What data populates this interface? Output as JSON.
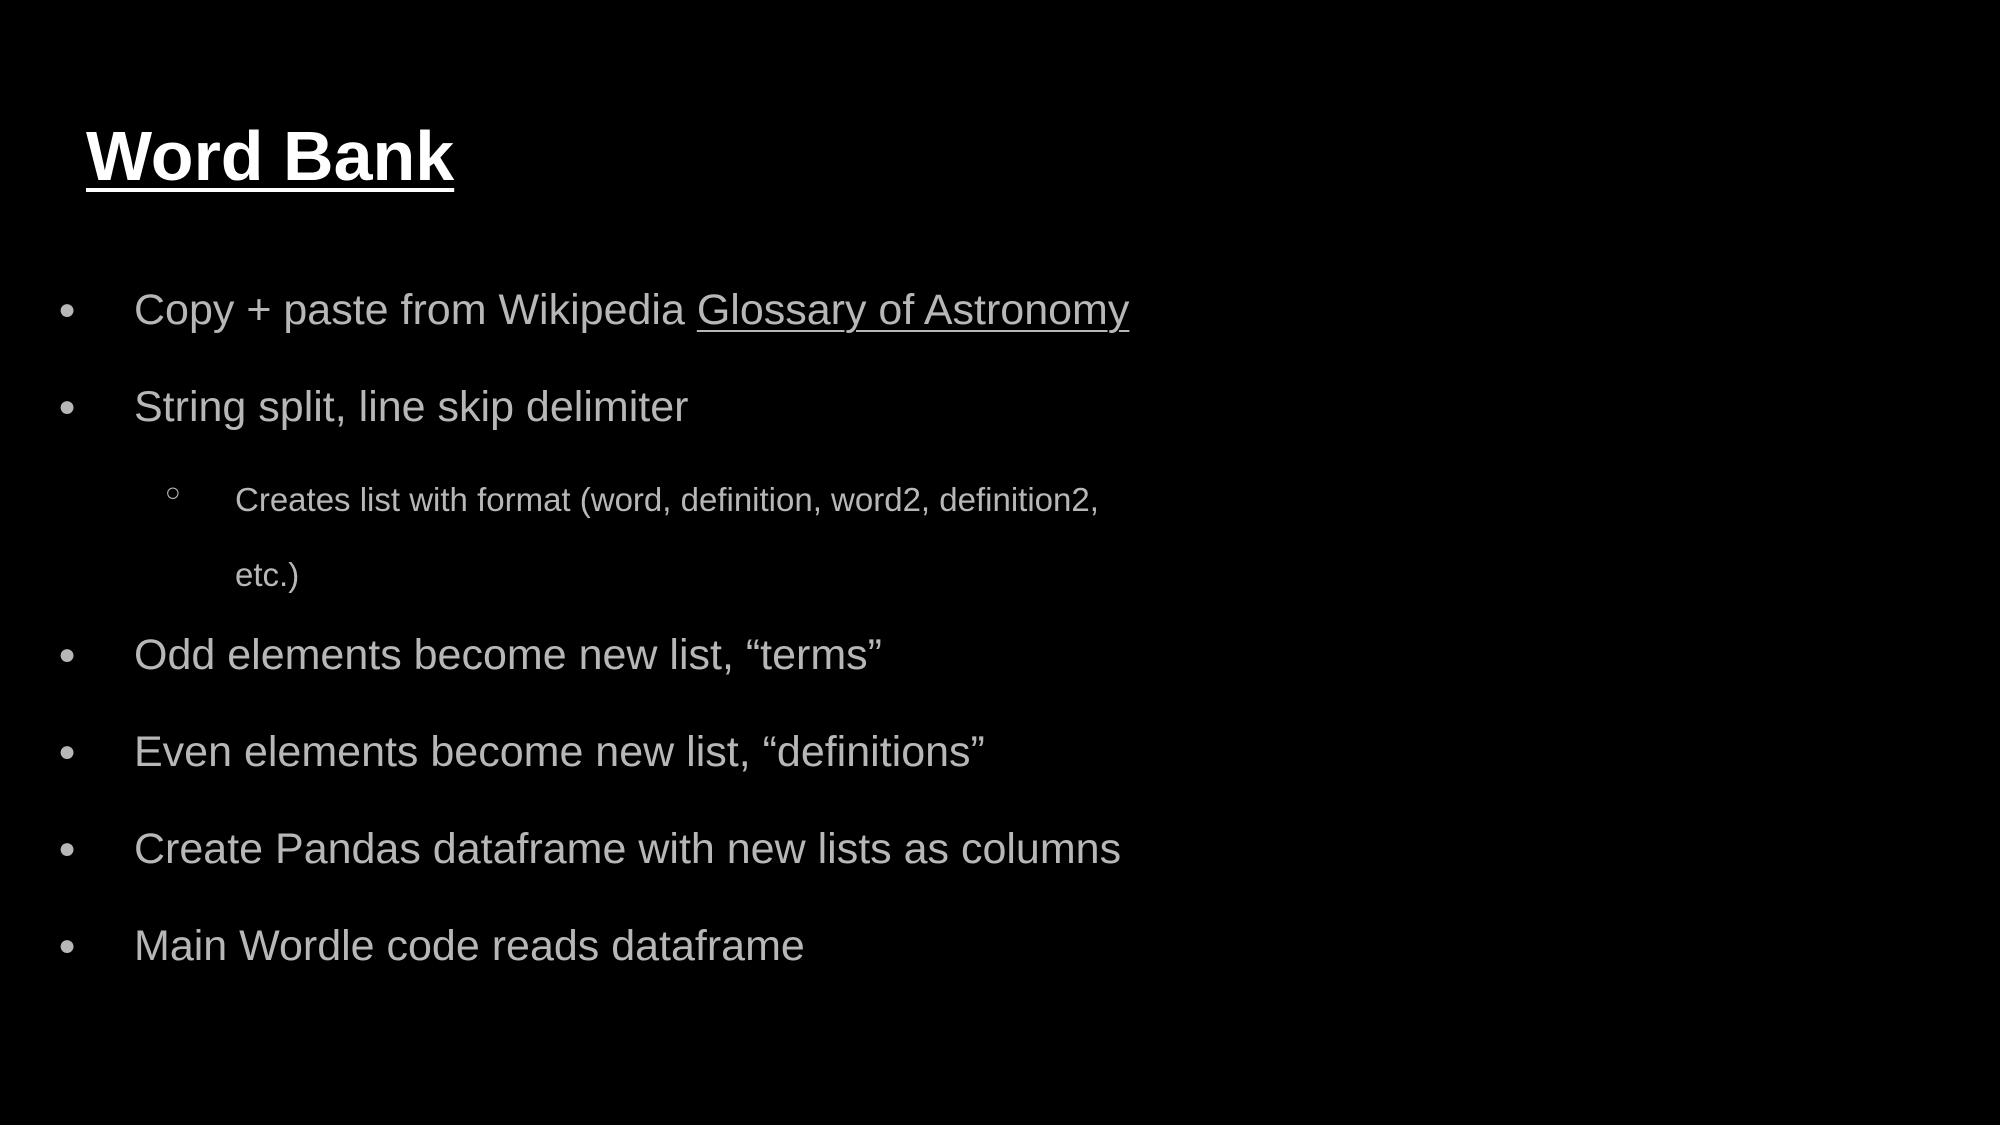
{
  "slide": {
    "title": "Word Bank",
    "bullet_glyph": "●",
    "sub_bullet_glyph": "○",
    "items": [
      {
        "text": "Copy + paste from Wikipedia ",
        "link_text": "Glossary of Astronomy"
      },
      {
        "text": "String split, line skip delimiter"
      },
      {
        "sub_text": "Creates list with format (word, definition, word2, definition2, etc.)"
      },
      {
        "text": "Odd elements become new list, “terms”"
      },
      {
        "text": "Even elements become new list, “definitions”"
      },
      {
        "text": "Create Pandas dataframe with new lists as columns"
      },
      {
        "text": "Main Wordle code reads dataframe"
      }
    ]
  },
  "colors": {
    "background": "#000000",
    "title": "#ffffff",
    "body_text": "#b7b7b7"
  }
}
